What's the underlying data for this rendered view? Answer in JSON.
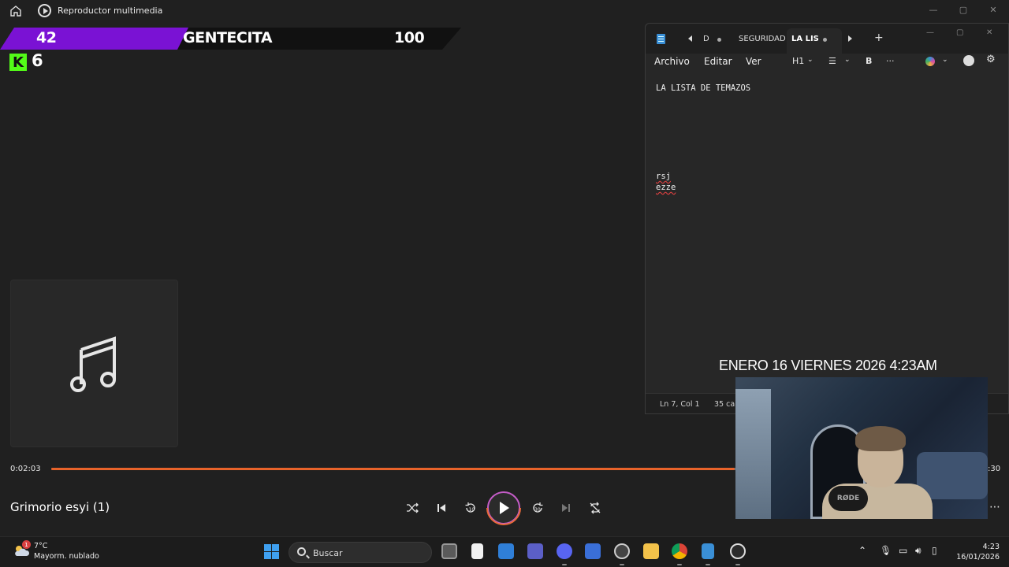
{
  "player": {
    "window_title": "Reproductor multimedia",
    "track_title": "Grimorio esyi (1)",
    "elapsed": "0:02:03",
    "remaining_fragment": ":30",
    "progress_fraction": 0.735
  },
  "overlay": {
    "left_number": "42",
    "center_label": "GENTECITA",
    "right_number": "100",
    "kick_letter": "K",
    "kick_count": "6",
    "date_text": "ENERO 16 VIERNES 2026 4:23AM",
    "webcam_mic_label": "RØDE"
  },
  "notepad": {
    "tabs": [
      "D",
      "SEGURIDAD",
      "LA LIS"
    ],
    "menu": [
      "Archivo",
      "Editar",
      "Ver"
    ],
    "heading_tool": "H1",
    "bold_tool": "B",
    "more_tool": "···",
    "content_line1": "LA LISTA DE TEMAZOS",
    "content_line2": "rsj",
    "content_line3": "ezze",
    "status_position": "Ln 7, Col 1",
    "status_chars": "35 car"
  },
  "taskbar": {
    "weather_temp": "7°C",
    "weather_condition": "Mayorm. nublado",
    "weather_badge": "1",
    "search_placeholder": "Buscar",
    "clock_time": "4:23",
    "clock_date": "16/01/2026"
  },
  "colors": {
    "accent_orange": "#e8632a",
    "overlay_purple": "#7a12d4",
    "kick_green": "#53fc18"
  }
}
